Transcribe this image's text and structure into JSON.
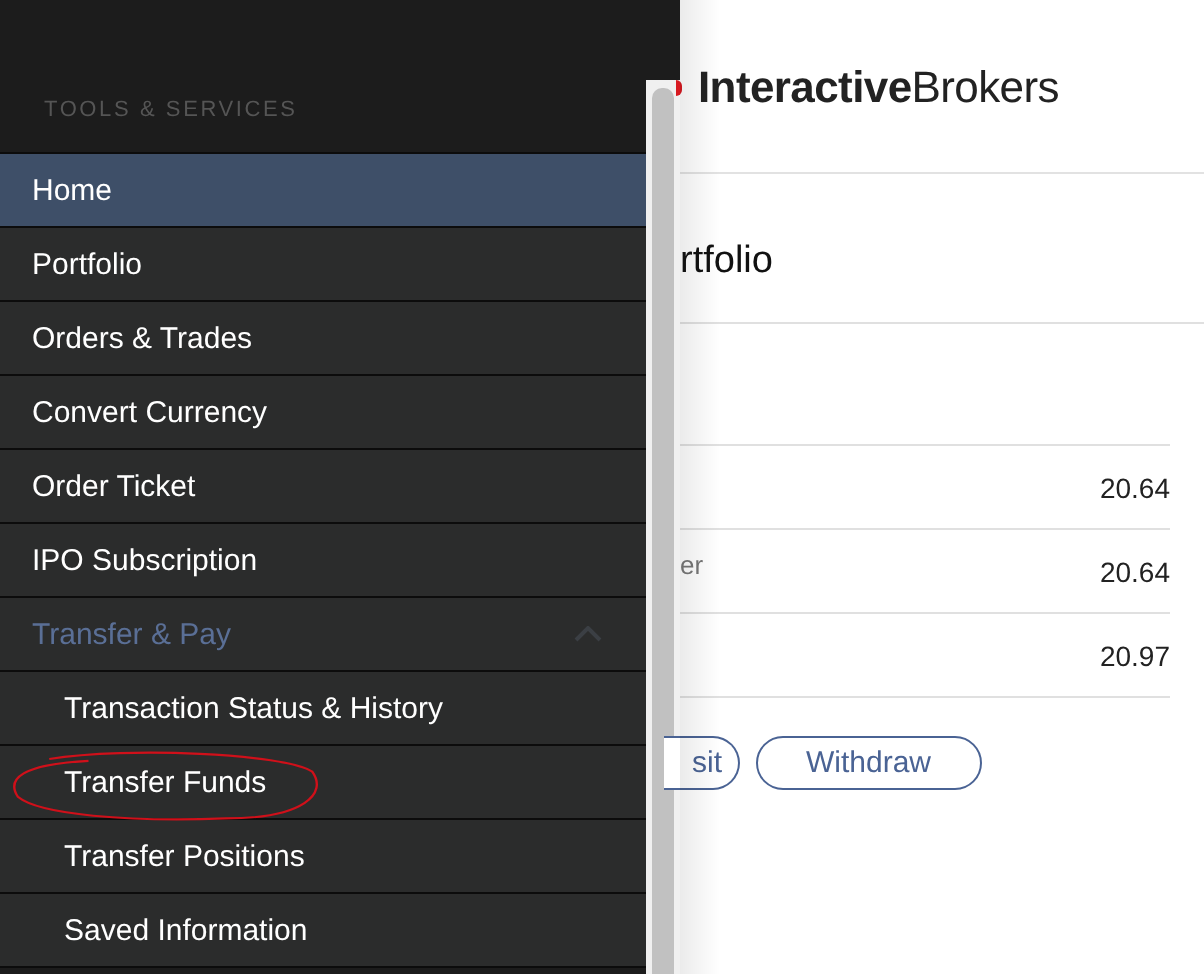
{
  "sidebar": {
    "section_title": "TOOLS & SERVICES",
    "items": [
      {
        "label": "Home",
        "selected": true
      },
      {
        "label": "Portfolio",
        "selected": false
      },
      {
        "label": "Orders & Trades",
        "selected": false
      },
      {
        "label": "Convert Currency",
        "selected": false
      },
      {
        "label": "Order Ticket",
        "selected": false
      },
      {
        "label": "IPO Subscription",
        "selected": false
      },
      {
        "label": "Transfer & Pay",
        "selected": false,
        "expanded": true,
        "children": [
          {
            "label": "Transaction Status & History",
            "selected": false,
            "annotated": false
          },
          {
            "label": "Transfer Funds",
            "selected": false,
            "annotated": true
          },
          {
            "label": "Transfer Positions",
            "selected": false,
            "annotated": false
          },
          {
            "label": "Saved Information",
            "selected": false,
            "annotated": false
          }
        ]
      }
    ]
  },
  "header": {
    "logo": "**Interactive**Brokers"
  },
  "page": {
    "heading": "rtfolio",
    "rows": [
      {
        "label": "",
        "value": "20.64"
      },
      {
        "label": "er",
        "value": "20.64"
      },
      {
        "label": "",
        "value": "20.97"
      }
    ],
    "buttons": [
      "sit",
      "Withdraw"
    ]
  }
}
